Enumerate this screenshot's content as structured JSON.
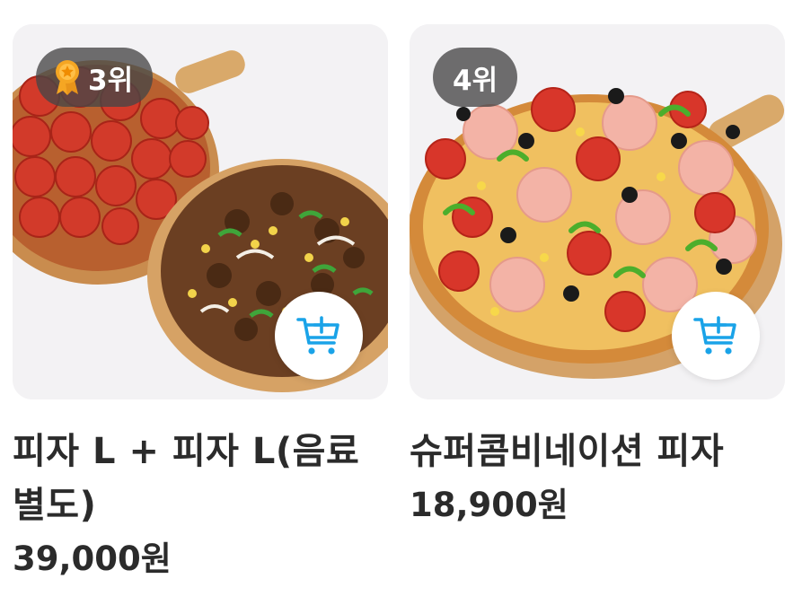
{
  "products": [
    {
      "rank_label": "3위",
      "has_medal": true,
      "name": "피자 L + 피자 L(음료별도)",
      "price": "39,000원",
      "image": "pepperoni-and-bulgogi-pizza-photo",
      "cart_icon": "cart-add-icon"
    },
    {
      "rank_label": "4위",
      "has_medal": false,
      "name": "슈퍼콤비네이션 피자",
      "price": "18,900원",
      "image": "super-combination-pizza-photo",
      "cart_icon": "cart-add-icon"
    }
  ],
  "colors": {
    "accent": "#1aa3e8",
    "medal": "#f5a623",
    "badge_bg": "#464646",
    "text": "#2b2b2b"
  }
}
